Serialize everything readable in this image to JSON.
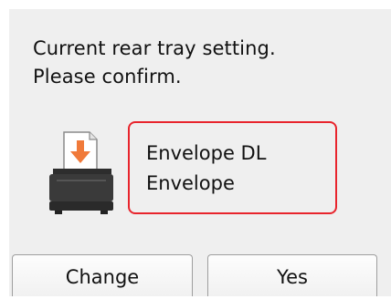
{
  "message": {
    "line1": "Current rear tray setting.",
    "line2": "Please confirm."
  },
  "setting": {
    "size": "Envelope DL",
    "type": "Envelope"
  },
  "icons": {
    "tray": "printer-rear-tray-icon",
    "feed": "down-arrow-icon"
  },
  "colors": {
    "highlight_border": "#e8242c",
    "feed_arrow": "#f07a3a",
    "screen_background": "#efefef"
  },
  "buttons": {
    "change_label": "Change",
    "yes_label": "Yes"
  }
}
